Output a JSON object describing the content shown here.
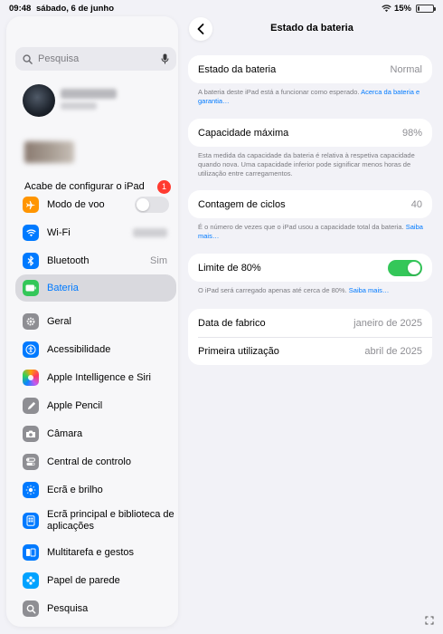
{
  "status_bar": {
    "time": "09:48",
    "date": "sábado, 6 de junho",
    "battery_percent": "15%",
    "battery_level": 0.15
  },
  "sidebar": {
    "search_placeholder": "Pesquisa",
    "setup": {
      "label": "Acabe de configurar o iPad",
      "badge": "1"
    },
    "items": [
      {
        "label": "Modo de voo",
        "icon": "airplane-icon",
        "color": "#ff9500",
        "toggle": "off"
      },
      {
        "label": "Wi-Fi",
        "icon": "wifi-icon",
        "color": "#007aff"
      },
      {
        "label": "Bluetooth",
        "icon": "bluetooth-icon",
        "color": "#007aff",
        "value": "Sim"
      },
      {
        "label": "Bateria",
        "icon": "battery-icon",
        "color": "#34c759",
        "selected": true
      },
      {
        "label": "Geral",
        "icon": "gear-icon",
        "color": "#8e8e93"
      },
      {
        "label": "Acessibilidade",
        "icon": "accessibility-icon",
        "color": "#007aff"
      },
      {
        "label": "Apple Intelligence e Siri",
        "icon": "siri-icon",
        "color": "#c86bfa"
      },
      {
        "label": "Apple Pencil",
        "icon": "pencil-icon",
        "color": "#8e8e93"
      },
      {
        "label": "Câmara",
        "icon": "camera-icon",
        "color": "#8e8e93"
      },
      {
        "label": "Central de controlo",
        "icon": "control-center-icon",
        "color": "#8e8e93"
      },
      {
        "label": "Ecrã e brilho",
        "icon": "brightness-icon",
        "color": "#007aff"
      },
      {
        "label": "Ecrã principal e biblioteca de aplicações",
        "icon": "home-screen-icon",
        "color": "#007aff"
      },
      {
        "label": "Multitarefa e gestos",
        "icon": "multitasking-icon",
        "color": "#007aff"
      },
      {
        "label": "Papel de parede",
        "icon": "wallpaper-icon",
        "color": "#00a2ff"
      },
      {
        "label": "Pesquisa",
        "icon": "search-icon",
        "color": "#8e8e93"
      }
    ]
  },
  "detail": {
    "title": "Estado da bateria",
    "health": {
      "label": "Estado da bateria",
      "value": "Normal",
      "note": "A bateria deste iPad está a funcionar como esperado.",
      "link": "Acerca da bateria e garantia…"
    },
    "capacity": {
      "label": "Capacidade máxima",
      "value": "98%",
      "note": "Esta medida da capacidade da bateria é relativa à respetiva capacidade quando nova. Uma capacidade inferior pode significar menos horas de utilização entre carregamentos."
    },
    "cycles": {
      "label": "Contagem de ciclos",
      "value": "40",
      "note": "É o número de vezes que o iPad usou a capacidade total da bateria.",
      "link": "Saiba mais…"
    },
    "limit": {
      "label": "Limite de 80%",
      "toggle": "on",
      "note": "O iPad será carregado apenas até cerca de 80%.",
      "link": "Saiba mais…"
    },
    "dates": {
      "manufacture_label": "Data de fabrico",
      "manufacture_value": "janeiro de 2025",
      "first_use_label": "Primeira utilização",
      "first_use_value": "abril de 2025"
    }
  }
}
